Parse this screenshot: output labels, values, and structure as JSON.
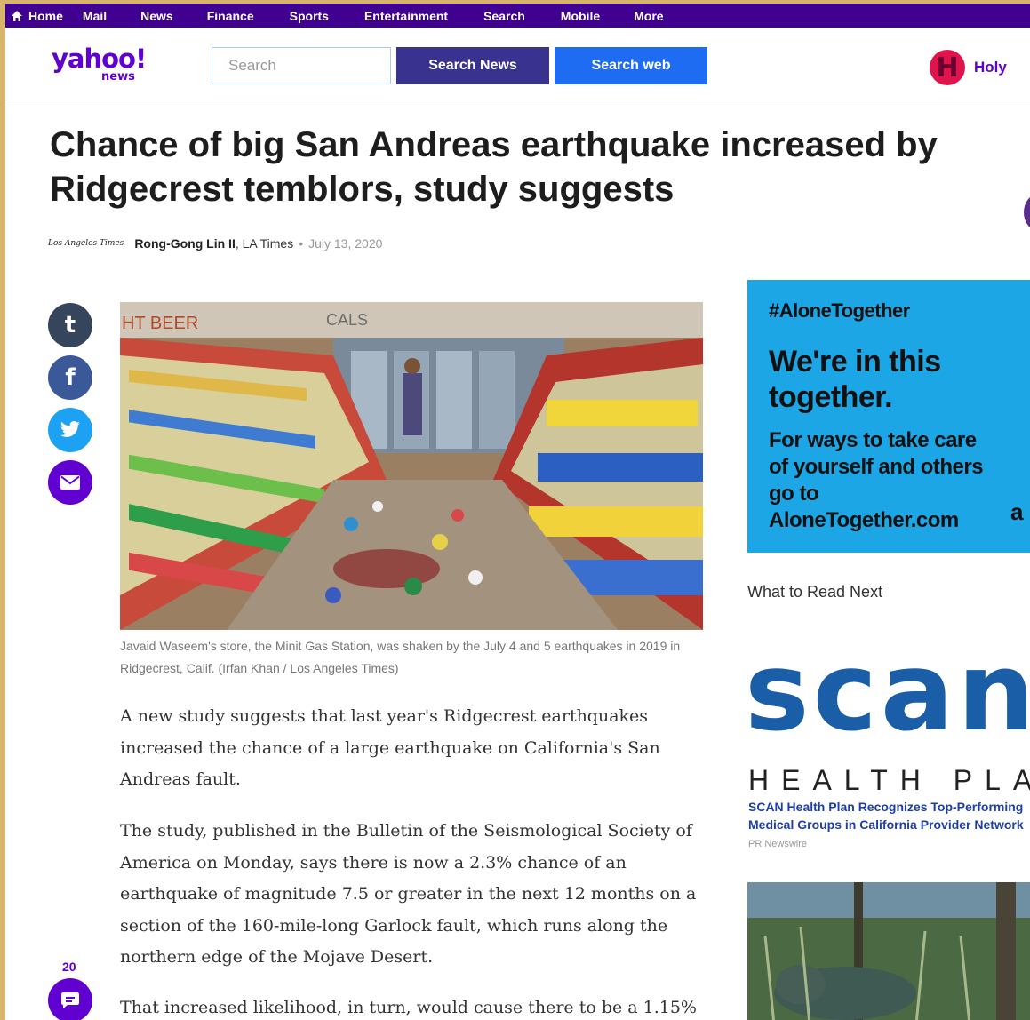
{
  "nav": {
    "items": [
      "Home",
      "Mail",
      "News",
      "Finance",
      "Sports",
      "Entertainment",
      "Search",
      "Mobile",
      "More"
    ]
  },
  "header": {
    "logo_main": "yahoo!",
    "logo_sub": "news",
    "search_placeholder": "Search",
    "search_news_label": "Search News",
    "search_web_label": "Search web",
    "user_initial": "H",
    "user_name": "Holy"
  },
  "article": {
    "headline": "Chance of big San Andreas earthquake increased by Ridgecrest temblors, study suggests",
    "publisher_logo": "Los Angeles Times",
    "author": "Rong-Gong Lin II",
    "source": ", LA Times",
    "separator": "•",
    "date": "July 13, 2020",
    "caption": "Javaid Waseem's store, the Minit Gas Station, was shaken by the July 4 and 5 earthquakes in 2019 in Ridgecrest, Calif. (Irfan Khan / Los Angeles Times)",
    "paragraphs": [
      "A new study suggests that last year's Ridgecrest earthquakes increased the chance of a large earthquake on California's San Andreas fault.",
      "The study, published in the Bulletin of the Seismological Society of America on Monday, says there is now a 2.3% chance of an earthquake of magnitude 7.5 or greater in the next 12 months on a section of the 160-mile-long Garlock fault, which runs along the northern edge of the Mojave Desert.",
      "That increased likelihood, in turn, would cause there to be a 1.15%"
    ],
    "comment_count": "20"
  },
  "share": {
    "tumblr_glyph": "t",
    "facebook_glyph": "f"
  },
  "photo_signs": {
    "beer": "HT BEER",
    "cals": "CALS"
  },
  "rail": {
    "ad_tag": "#AloneTogether",
    "ad_headline": "We're in this together.",
    "ad_body": "For ways to take care of yourself and others go to AloneTogether.com",
    "ad_mark": "a",
    "read_next": "What to Read Next",
    "scan_logo": "scan",
    "scan_sub": "HEALTH PLAN",
    "scan_headline": "SCAN Health Plan Recognizes Top-Performing Medical Groups in California Provider Network",
    "scan_source": "PR Newswire"
  },
  "colors": {
    "nav_bg": "#400090",
    "brand": "#6001d2",
    "search_news_bg": "#39328f",
    "search_web_bg": "#1d6cf2",
    "ad_bg": "#1ca6e6",
    "scan_blue": "#1b5ea8"
  }
}
